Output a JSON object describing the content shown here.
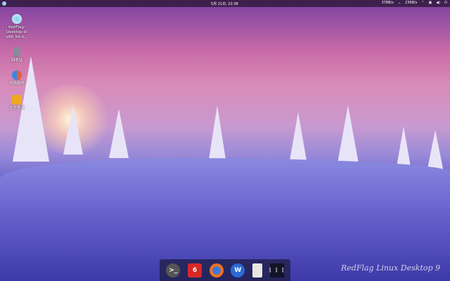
{
  "topbar": {
    "clock": "5月 21日, 22:38",
    "net_down": "378B/s",
    "net_up": "236B/s"
  },
  "desktop_icons": [
    {
      "label": "RedFlag-Desktop-9-x86_64-0..."
    },
    {
      "label": "回收站"
    },
    {
      "label": "网络服务"
    },
    {
      "label": "主文件夹"
    }
  ],
  "dock": [
    {
      "name": "terminal"
    },
    {
      "name": "netease-music"
    },
    {
      "name": "firefox"
    },
    {
      "name": "wps"
    },
    {
      "name": "text-editor"
    },
    {
      "name": "app-launcher"
    }
  ],
  "branding": "RedFlag Linux Desktop 9"
}
